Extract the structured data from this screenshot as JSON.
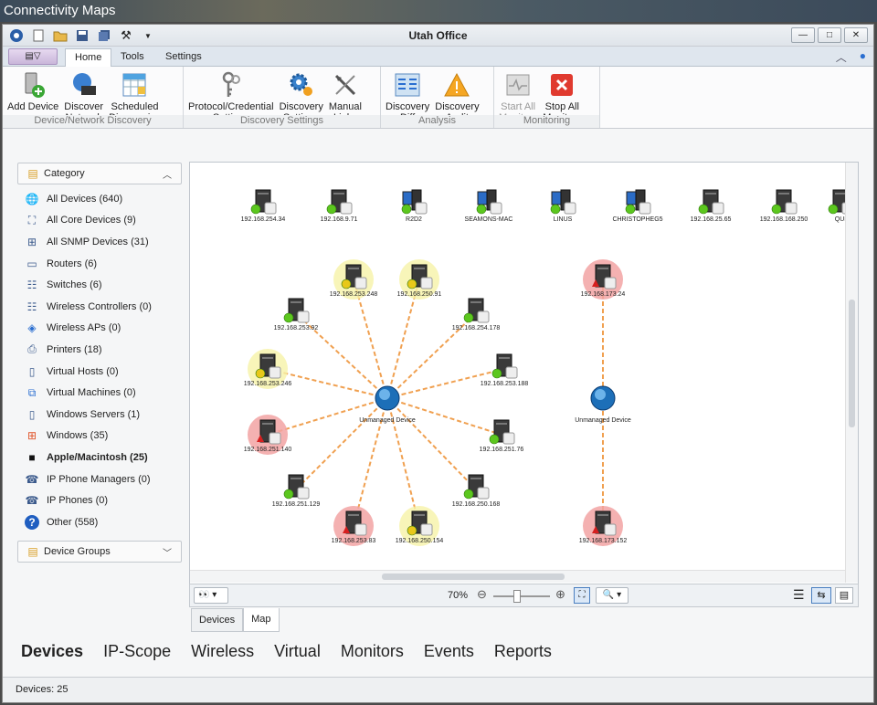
{
  "desktop_title": "Connectivity Maps",
  "window": {
    "title": "Utah Office"
  },
  "ribbon_tabs": [
    "Home",
    "Tools",
    "Settings"
  ],
  "ribbon": {
    "groups": [
      {
        "label": "Device/Network Discovery",
        "buttons": [
          {
            "label": [
              "Add Device"
            ],
            "icon": "add-device-icon"
          },
          {
            "label": [
              "Discover",
              "Network"
            ],
            "icon": "discover-network-icon"
          },
          {
            "label": [
              "Scheduled",
              "Discoveries"
            ],
            "icon": "scheduled-discoveries-icon"
          }
        ]
      },
      {
        "label": "Discovery Settings",
        "buttons": [
          {
            "label": [
              "Protocol/Credential",
              "Settings"
            ],
            "icon": "keys-icon"
          },
          {
            "label": [
              "Discovery",
              "Settings"
            ],
            "icon": "gears-icon"
          },
          {
            "label": [
              "Manual",
              "Links"
            ],
            "icon": "manual-links-icon"
          }
        ]
      },
      {
        "label": "Analysis",
        "buttons": [
          {
            "label": [
              "Discovery",
              "Diff"
            ],
            "icon": "diff-icon"
          },
          {
            "label": [
              "Discovery",
              "Audit"
            ],
            "icon": "warning-icon"
          }
        ]
      },
      {
        "label": "Monitoring",
        "buttons": [
          {
            "label": [
              "Start All",
              "Monitors"
            ],
            "icon": "start-monitors-icon",
            "disabled": true
          },
          {
            "label": [
              "Stop All",
              "Monitors"
            ],
            "icon": "stop-monitors-icon"
          }
        ]
      }
    ]
  },
  "sidebar": {
    "category_header": "Category",
    "items": [
      {
        "label": "All Devices (640)",
        "icon": "globe-user-icon"
      },
      {
        "label": "All Core Devices (9)",
        "icon": "network-icon"
      },
      {
        "label": "All SNMP Devices (31)",
        "icon": "snmp-icon"
      },
      {
        "label": "Routers (6)",
        "icon": "router-icon"
      },
      {
        "label": "Switches (6)",
        "icon": "switch-icon"
      },
      {
        "label": "Wireless Controllers (0)",
        "icon": "wireless-controller-icon"
      },
      {
        "label": "Wireless APs (0)",
        "icon": "wireless-ap-icon"
      },
      {
        "label": "Printers (18)",
        "icon": "printer-icon"
      },
      {
        "label": "Virtual Hosts (0)",
        "icon": "virtual-host-icon"
      },
      {
        "label": "Virtual Machines (0)",
        "icon": "virtual-machine-icon"
      },
      {
        "label": "Windows Servers (1)",
        "icon": "windows-server-icon"
      },
      {
        "label": "Windows (35)",
        "icon": "windows-icon"
      },
      {
        "label": "Apple/Macintosh (25)",
        "icon": "apple-icon",
        "selected": true
      },
      {
        "label": "IP Phone Managers (0)",
        "icon": "ip-phone-manager-icon"
      },
      {
        "label": "IP Phones (0)",
        "icon": "ip-phone-icon"
      },
      {
        "label": "Other (558)",
        "icon": "help-icon"
      }
    ],
    "groups_header": "Device Groups"
  },
  "map": {
    "top_row": [
      "192.168.254.34",
      "192.168.9.71",
      "R2D2",
      "SEAMONS-MAC",
      "LINUS",
      "CHRISTOPHEG5",
      "192.168.25.65",
      "192.168.168.250",
      "QUI"
    ],
    "hub1_label": "Unmanaged Device",
    "hub2_label": "Unmanaged Device",
    "hub1_nodes": [
      {
        "label": "192.168.253.248",
        "status": "warn-yellow"
      },
      {
        "label": "192.168.250.91",
        "status": "warn-yellow"
      },
      {
        "label": "192.168.254.178",
        "status": "ok"
      },
      {
        "label": "192.168.253.188",
        "status": "ok"
      },
      {
        "label": "192.168.251.76",
        "status": "ok"
      },
      {
        "label": "192.168.250.168",
        "status": "ok"
      },
      {
        "label": "192.168.250.154",
        "status": "warn-yellow"
      },
      {
        "label": "192.168.253.83",
        "status": "down"
      },
      {
        "label": "192.168.251.129",
        "status": "ok"
      },
      {
        "label": "192.168.251.140",
        "status": "down"
      },
      {
        "label": "192.168.253.246",
        "status": "warn-yellow"
      },
      {
        "label": "192.168.253.92",
        "status": "ok"
      }
    ],
    "hub2_nodes": [
      {
        "label": "192.168.173.24",
        "status": "down"
      },
      {
        "label": "192.168.173.152",
        "status": "down"
      }
    ],
    "zoom": "70%"
  },
  "bottom_tabs": [
    "Devices",
    "Map"
  ],
  "nav": [
    "Devices",
    "IP-Scope",
    "Wireless",
    "Virtual",
    "Monitors",
    "Events",
    "Reports"
  ],
  "status": "Devices: 25"
}
